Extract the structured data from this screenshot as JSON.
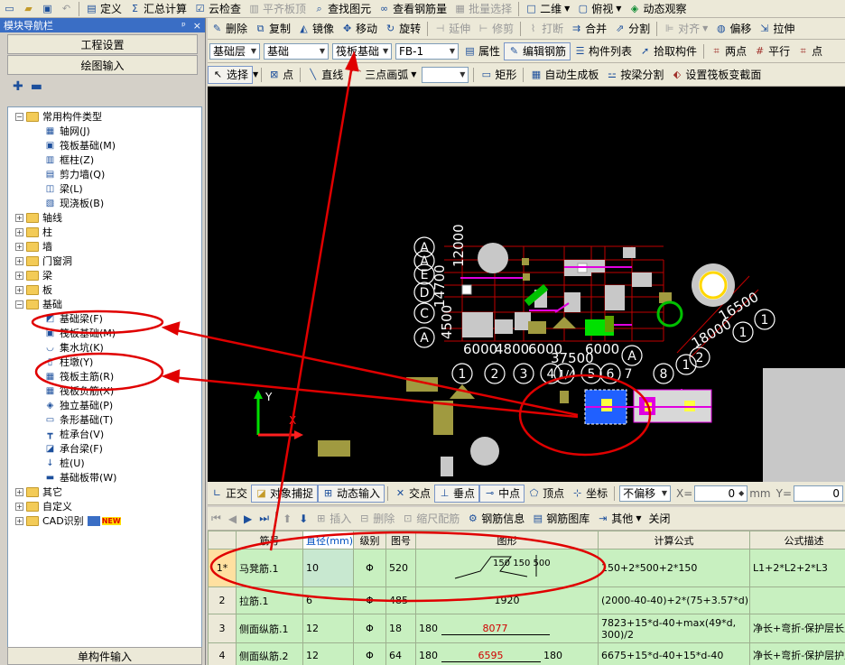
{
  "menubar": {
    "items": [
      "定义",
      "汇总计算",
      "云检查",
      "平齐板顶",
      "查找图元",
      "查看钢筋量",
      "批量选择",
      "二维",
      "俯视",
      "动态观察"
    ]
  },
  "toolbar1": {
    "delete": "删除",
    "copy": "复制",
    "mirror": "镜像",
    "move": "移动",
    "rotate": "旋转",
    "extend": "延伸",
    "trim": "修剪",
    "break": "打断",
    "merge": "合并",
    "split": "分割",
    "align": "对齐",
    "offset": "偏移",
    "stretch": "拉伸"
  },
  "toolbar2": {
    "layer": "基础层",
    "floor": "基础",
    "type": "筏板基础",
    "name": "FB-1",
    "props": "属性",
    "edit_rebar": "编辑钢筋",
    "comp_list": "构件列表",
    "pick": "拾取构件",
    "two_point": "两点",
    "parallel": "平行",
    "angle": "点"
  },
  "toolbar3": {
    "select": "选择",
    "point": "点",
    "line": "直线",
    "arc3": "三点画弧",
    "rect": "矩形",
    "autogen": "自动生成板",
    "split_beam": "按梁分割",
    "set_section": "设置筏板变截面"
  },
  "nav": {
    "title": "模块导航栏",
    "pin": "ᵖ",
    "close": "×",
    "btn_project": "工程设置",
    "btn_draw": "绘图输入",
    "single": "单构件输入",
    "tree": [
      {
        "lvl": 0,
        "pm": "−",
        "type": "folder",
        "label": "常用构件类型"
      },
      {
        "lvl": 1,
        "type": "item",
        "icon": "▦",
        "label": "轴网(J)"
      },
      {
        "lvl": 1,
        "type": "item",
        "icon": "▣",
        "label": "筏板基础(M)"
      },
      {
        "lvl": 1,
        "type": "item",
        "icon": "▥",
        "label": "框柱(Z)"
      },
      {
        "lvl": 1,
        "type": "item",
        "icon": "▤",
        "label": "剪力墙(Q)"
      },
      {
        "lvl": 1,
        "type": "item",
        "icon": "◫",
        "label": "梁(L)"
      },
      {
        "lvl": 1,
        "type": "item",
        "icon": "▧",
        "label": "现浇板(B)"
      },
      {
        "lvl": 0,
        "pm": "+",
        "type": "folder",
        "label": "轴线"
      },
      {
        "lvl": 0,
        "pm": "+",
        "type": "folder",
        "label": "柱"
      },
      {
        "lvl": 0,
        "pm": "+",
        "type": "folder",
        "label": "墙"
      },
      {
        "lvl": 0,
        "pm": "+",
        "type": "folder",
        "label": "门窗洞"
      },
      {
        "lvl": 0,
        "pm": "+",
        "type": "folder",
        "label": "梁"
      },
      {
        "lvl": 0,
        "pm": "+",
        "type": "folder",
        "label": "板"
      },
      {
        "lvl": 0,
        "pm": "−",
        "type": "folder",
        "label": "基础"
      },
      {
        "lvl": 1,
        "type": "item",
        "icon": "◩",
        "label": "基础梁(F)"
      },
      {
        "lvl": 1,
        "type": "item",
        "icon": "▣",
        "label": "筏板基础(M)"
      },
      {
        "lvl": 1,
        "type": "item",
        "icon": "◡",
        "label": "集水坑(K)"
      },
      {
        "lvl": 1,
        "type": "item",
        "icon": "▯",
        "label": "柱墩(Y)"
      },
      {
        "lvl": 1,
        "type": "item",
        "icon": "▦",
        "label": "筏板主筋(R)"
      },
      {
        "lvl": 1,
        "type": "item",
        "icon": "▦",
        "label": "筏板负筋(X)"
      },
      {
        "lvl": 1,
        "type": "item",
        "icon": "◈",
        "label": "独立基础(P)"
      },
      {
        "lvl": 1,
        "type": "item",
        "icon": "▭",
        "label": "条形基础(T)"
      },
      {
        "lvl": 1,
        "type": "item",
        "icon": "┳",
        "label": "桩承台(V)"
      },
      {
        "lvl": 1,
        "type": "item",
        "icon": "◪",
        "label": "承台梁(F)"
      },
      {
        "lvl": 1,
        "type": "item",
        "icon": "↓",
        "label": "桩(U)"
      },
      {
        "lvl": 1,
        "type": "item",
        "icon": "▬",
        "label": "基础板带(W)"
      },
      {
        "lvl": 0,
        "pm": "+",
        "type": "folder",
        "label": "其它"
      },
      {
        "lvl": 0,
        "pm": "+",
        "type": "folder",
        "label": "自定义"
      },
      {
        "lvl": 0,
        "pm": "+",
        "type": "folder",
        "label": "CAD识别",
        "badge": "NEW"
      }
    ]
  },
  "canvas": {
    "axis_labels_left": [
      "A",
      "A",
      "E",
      "D",
      "C",
      "B",
      "A"
    ],
    "axis_nums_bottom": [
      "1",
      "2",
      "3",
      "4",
      "1/4",
      "5",
      "6",
      "7",
      "A",
      "8",
      "1",
      "2",
      "3"
    ],
    "dims": [
      "6000",
      "4800",
      "6000",
      "37500",
      "4500",
      "14700",
      "12000",
      "18000",
      "16500"
    ],
    "ucs_y": "Y",
    "ucs_x": "X"
  },
  "snapbar": {
    "ortho": "正交",
    "snap": "对象捕捉",
    "dyn": "动态输入",
    "inter": "交点",
    "perp": "垂点",
    "mid": "中点",
    "vertex": "顶点",
    "coord": "坐标",
    "offset": "不偏移",
    "x_label": "X=",
    "x_val": "0",
    "mm": "mm",
    "y_label": "Y=",
    "y_val": "0"
  },
  "rebarbar": {
    "insert": "插入",
    "delete": "删除",
    "scale": "缩尺配筋",
    "info": "钢筋信息",
    "lib": "钢筋图库",
    "other": "其他",
    "close": "关闭"
  },
  "table": {
    "headers": [
      "筋号",
      "直径(mm)",
      "级别",
      "图号",
      "图形",
      "计算公式",
      "公式描述"
    ],
    "rows": [
      {
        "rn": "1*",
        "name": "马凳筋.1",
        "dia": "10",
        "grade": "Φ",
        "fig": "520",
        "shape": "150 150 500",
        "formula": "150+2*500+2*150",
        "desc": "L1+2*L2+2*L3"
      },
      {
        "rn": "2",
        "name": "拉筋.1",
        "dia": "6",
        "grade": "Φ",
        "fig": "485",
        "shape": "1920",
        "formula": "(2000-40-40)+2*(75+3.57*d)",
        "desc": ""
      },
      {
        "rn": "3",
        "name": "侧面纵筋.1",
        "dia": "12",
        "grade": "Φ",
        "fig": "18",
        "shape_l": "180",
        "shape": "8077",
        "formula": "7823+15*d-40+max(49*d, 300)/2",
        "desc": "净长+弯折-保护层长度"
      },
      {
        "rn": "4",
        "name": "侧面纵筋.2",
        "dia": "12",
        "grade": "Φ",
        "fig": "64",
        "shape_l": "180",
        "shape": "6595",
        "shape_r": "180",
        "formula": "6675+15*d-40+15*d-40",
        "desc": "净长+弯折-保护层护层"
      }
    ]
  }
}
